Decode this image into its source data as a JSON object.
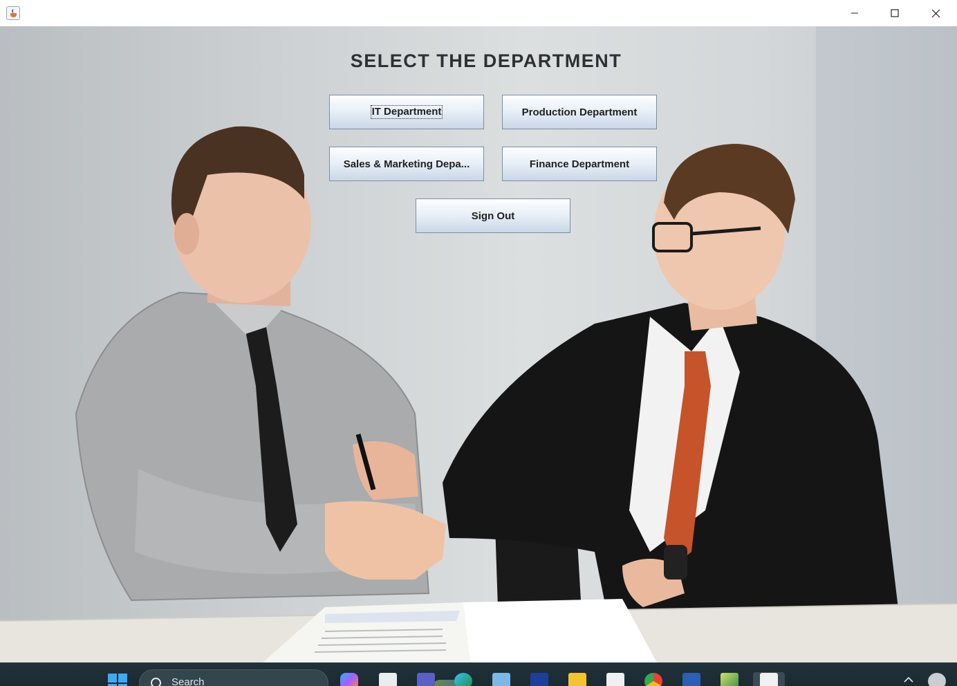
{
  "window": {
    "title": "",
    "controls": [
      "minimize",
      "maximize",
      "close"
    ]
  },
  "page": {
    "heading": "SELECT THE DEPARTMENT",
    "buttons": {
      "it": "IT Department",
      "production": "Production Department",
      "sales": "Sales & Marketing Depa...",
      "finance": "Finance Department",
      "sign_out": "Sign Out"
    },
    "background_image": "two businessmen shaking hands at a desk"
  },
  "taskbar": {
    "search_placeholder": "Search",
    "apps": [
      "start-icon",
      "copilot-icon",
      "task-view-icon",
      "teams-icon",
      "edge-icon",
      "app-icon",
      "launcher-icon",
      "file-explorer-icon",
      "store-icon",
      "chrome-icon",
      "word-icon",
      "app-cube-icon",
      "java-app-icon"
    ]
  },
  "colors": {
    "button_border": "#7a8ea6",
    "button_gradient_top": "#fdfeff",
    "button_gradient_bottom": "#c9d7e7",
    "heading_text": "#2e3033",
    "taskbar_bg": "#1f2f37"
  }
}
